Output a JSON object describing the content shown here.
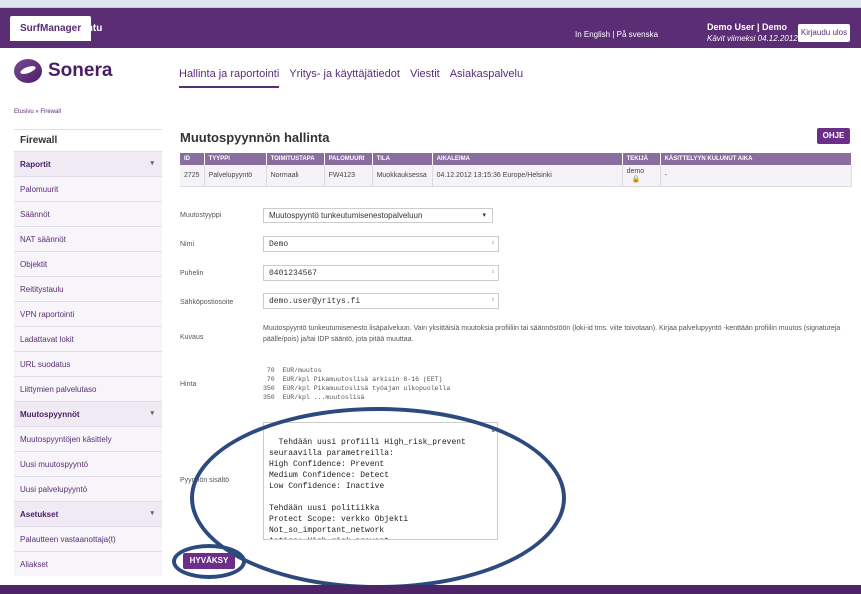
{
  "topbar": {
    "app_tab": "SurfManager",
    "app_tab2": "Intu",
    "language": "In English | På svenska",
    "user_name": "Demo User | Demo",
    "last_visit": "Kävit viimeksi 04.12.2012",
    "logout_label": "Kirjaudu ulos"
  },
  "brand": {
    "name": "Sonera",
    "logo_icon": "sonera-logo-icon",
    "accent_color": "#5a2d75"
  },
  "mainnav": [
    "Hallinta ja raportointi",
    "Yritys- ja käyttäjätiedot",
    "Viestit",
    "Asiakaspalvelu"
  ],
  "breadcrumb": "Etusivu » Firewall",
  "sidebar": {
    "title": "Firewall",
    "items": [
      {
        "label": "Raportit",
        "type": "head"
      },
      {
        "label": "Palomuurit",
        "type": "item"
      },
      {
        "label": "Säännöt",
        "type": "item"
      },
      {
        "label": "NAT säännöt",
        "type": "item"
      },
      {
        "label": "Objektit",
        "type": "item"
      },
      {
        "label": "Reititystaulu",
        "type": "item"
      },
      {
        "label": "VPN raportointi",
        "type": "item"
      },
      {
        "label": "Ladattavat lokit",
        "type": "item"
      },
      {
        "label": "URL suodatus",
        "type": "item"
      },
      {
        "label": "Liittymien palvelutaso",
        "type": "item"
      },
      {
        "label": "Muutospyynnöt",
        "type": "head"
      },
      {
        "label": "Muutospyyntöjen käsittely",
        "type": "item"
      },
      {
        "label": "Uusi muutospyyntö",
        "type": "item"
      },
      {
        "label": "Uusi palvelupyyntö",
        "type": "item"
      },
      {
        "label": "Asetukset",
        "type": "head"
      },
      {
        "label": "Palautteen vastaanottaja(t)",
        "type": "item"
      },
      {
        "label": "Aliakset",
        "type": "item"
      }
    ]
  },
  "page": {
    "title": "Muutospyynnön hallinta",
    "help_label": "OHJE"
  },
  "table": {
    "headers": [
      "ID",
      "TYYPPI",
      "TOIMITUSTAPA",
      "PALOMUURI",
      "TILA",
      "AIKALEIMA",
      "TEKIJÄ",
      "KÄSITTELYYN KULUNUT AIKA"
    ],
    "row": [
      "2725",
      "Palvelupyyntö",
      "Normaali",
      "FW4123",
      "Muokkauksessa",
      "04.12.2012 13:15:36 Europe/Helsinki",
      "demo",
      "-"
    ]
  },
  "form": {
    "type_label": "Muutostyyppi",
    "type_value": "Muutospyyntö tunkeutumisenestopalveluun",
    "name_label": "Nimi",
    "name_value": "Demo",
    "phone_label": "Puhelin",
    "phone_value": "0401234567",
    "email_label": "Sähköpostiosoite",
    "email_value": "demo.user@yritys.fi",
    "desc_label": "Kuvaus",
    "desc_text": "Muutospyyntö tunkeutumisenesto lisäpalveluun. Vain yksittäisiä muutoksia profiiliin tai säännöstöön (loki-id tms. viite toivotaan). Kirjaa palvelupyyntö -kenttään profiilin muutos (signatureja päälle/pois) ja/tai IDP sääntö, jota pitää muuttaa.",
    "price_label": "Hinta",
    "prices": [
      " 70  EUR/muutos",
      " 70  EUR/kpl Pikamuutoslisä arkisin 8-16 (EET)",
      "350  EUR/kpl Pikamuutoslisä työajan ulkopuolella",
      "350  EUR/kpl ...muutoslisä"
    ],
    "content_label": "Pyynnön sisältö",
    "content_text": "Tehdään uusi profiili High_risk_prevent\nseuraavilla parametreilla:\nHigh Confidence: Prevent\nMedium Confidence: Detect\nLow Confidence: Inactive\n\nTehdään uusi politiikka\nProtect Scope: verkko Objekti\nNot_so_important_network\nAction: High_risk_prevent",
    "accept_label": "HYVÄKSY"
  }
}
